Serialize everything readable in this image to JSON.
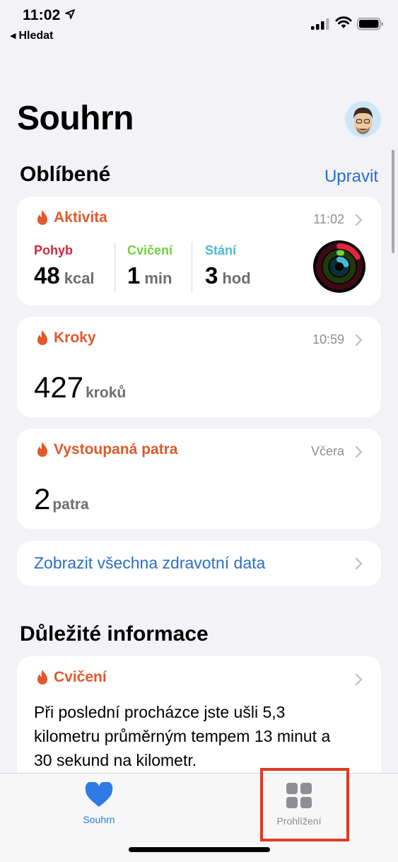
{
  "status_bar": {
    "time": "11:02",
    "back_label": "Hledat"
  },
  "header": {
    "title": "Souhrn"
  },
  "favorites": {
    "title": "Oblíbené",
    "edit_label": "Upravit",
    "activity": {
      "title": "Aktivita",
      "time": "11:02",
      "move": {
        "label": "Pohyb",
        "value": "48",
        "unit": "kcal"
      },
      "exercise": {
        "label": "Cvičení",
        "value": "1",
        "unit": "min"
      },
      "stand": {
        "label": "Stání",
        "value": "3",
        "unit": "hod"
      }
    },
    "steps": {
      "title": "Kroky",
      "time": "10:59",
      "value": "427",
      "unit": "kroků"
    },
    "floors": {
      "title": "Vystoupaná patra",
      "time": "Včera",
      "value": "2",
      "unit": "patra"
    },
    "show_all_label": "Zobrazit všechna zdravotní data"
  },
  "highlights": {
    "title": "Důležité informace",
    "card": {
      "title": "Cvičení",
      "text": "Při poslední procházce jste ušli 5,3 kilometru průměrným tempem 13 minut a 30 sekund na kilometr."
    }
  },
  "tabbar": {
    "summary_label": "Souhrn",
    "browse_label": "Prohlížení"
  },
  "colors": {
    "accent_orange": "#e0592a",
    "move": "#d0293d",
    "exercise": "#6fd23a",
    "stand": "#49b8d6",
    "link": "#2a6fca",
    "tab_active": "#2f7be3",
    "highlight_box": "#e03a25"
  }
}
